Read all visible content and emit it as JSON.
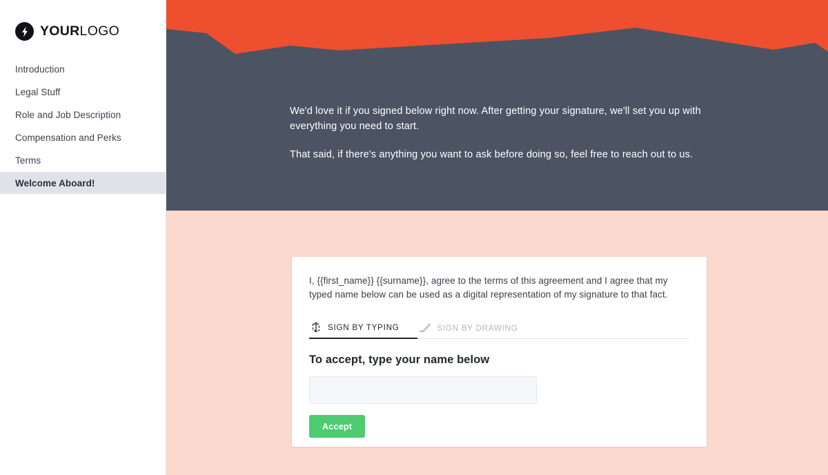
{
  "brand": {
    "logo_bold": "YOUR",
    "logo_light": "LOGO",
    "logo_icon": "lightning-bolt-icon"
  },
  "sidebar": {
    "items": [
      {
        "label": "Introduction",
        "active": false
      },
      {
        "label": "Legal Stuff",
        "active": false
      },
      {
        "label": "Role and Job Description",
        "active": false
      },
      {
        "label": "Compensation and Perks",
        "active": false
      },
      {
        "label": "Terms",
        "active": false
      },
      {
        "label": "Welcome Aboard!",
        "active": true
      }
    ]
  },
  "hero": {
    "paragraph_1": "We'd love it if you signed below right now. After getting your signature, we'll set you up with everything you need to start.",
    "paragraph_2": "That said, if there's anything you want to ask before doing so, feel free to reach out to us."
  },
  "card": {
    "consent_text": "I, {{first_name}} {{surname}}, agree to the terms of this agreement and I agree that my typed name below can be used as a digital representation of my signature to that fact.",
    "tabs": [
      {
        "label": "SIGN BY TYPING",
        "icon": "text-cursor-icon",
        "active": true
      },
      {
        "label": "SIGN BY DRAWING",
        "icon": "pen-icon",
        "active": false
      }
    ],
    "accept_heading": "To accept, type your name below",
    "name_input_value": "",
    "name_input_placeholder": "",
    "accept_button_label": "Accept"
  },
  "colors": {
    "orange": "#ee4f2e",
    "slate": "#4c5463",
    "peach": "#fbd9ce",
    "green": "#4ecb71",
    "active_nav": "#dfe3e9"
  }
}
